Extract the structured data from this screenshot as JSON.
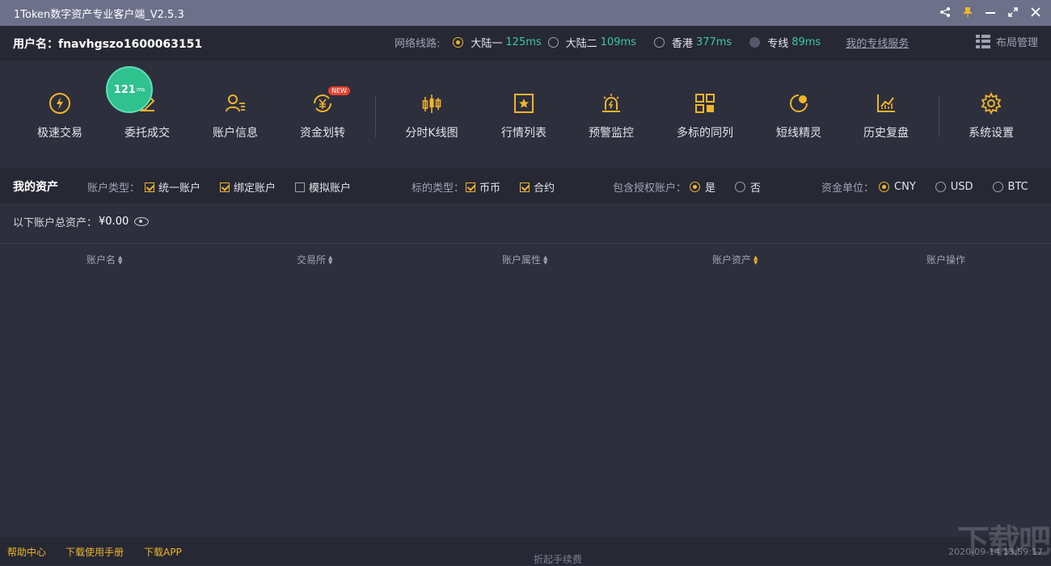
{
  "window": {
    "title": "1Token数字资产专业客户端_V2.5.3",
    "controls": [
      "share-icon",
      "pin-icon",
      "minimize-icon",
      "maximize-icon",
      "close-icon"
    ]
  },
  "user": {
    "label": "用户名：",
    "name": "fnavhgszo1600063151"
  },
  "network": {
    "label": "网络线路:",
    "options": [
      {
        "name": "大陆一",
        "ms": "125ms",
        "selected": true
      },
      {
        "name": "大陆二",
        "ms": "109ms",
        "selected": false
      },
      {
        "name": "香港",
        "ms": "377ms",
        "selected": false
      },
      {
        "name": "专线",
        "ms": "89ms",
        "selected": false
      }
    ],
    "service_link": "我的专线服务",
    "layout_label": "布局管理"
  },
  "ping": {
    "value": "121",
    "unit": "ms"
  },
  "toolbar": {
    "items": [
      {
        "label": "极速交易",
        "icon": "lightning-icon"
      },
      {
        "label": "委托成交",
        "icon": "edit-icon"
      },
      {
        "label": "账户信息",
        "icon": "user-info-icon"
      },
      {
        "label": "资金划转",
        "icon": "yuan-transfer-icon",
        "badge": "NEW"
      },
      {
        "label": "分时K线图",
        "icon": "candlestick-icon"
      },
      {
        "label": "行情列表",
        "icon": "star-list-icon"
      },
      {
        "label": "预警监控",
        "icon": "alarm-icon"
      },
      {
        "label": "多标的同列",
        "icon": "multi-grid-icon"
      },
      {
        "label": "短线精灵",
        "icon": "sprite-icon"
      },
      {
        "label": "历史复盘",
        "icon": "history-chart-icon"
      },
      {
        "label": "系统设置",
        "icon": "gear-icon"
      }
    ]
  },
  "assets": {
    "heading": "我的资产",
    "account_type_label": "账户类型：",
    "account_types": [
      {
        "label": "统一账户",
        "checked": true
      },
      {
        "label": "绑定账户",
        "checked": true
      },
      {
        "label": "模拟账户",
        "checked": false
      }
    ],
    "target_type_label": "标的类型：",
    "target_types": [
      {
        "label": "币币",
        "checked": true
      },
      {
        "label": "合约",
        "checked": true
      }
    ],
    "include_auth_label": "包含授权账户：",
    "include_auth": [
      {
        "label": "是",
        "selected": true
      },
      {
        "label": "否",
        "selected": false
      }
    ],
    "currency_label": "资金单位：",
    "currencies": [
      {
        "label": "CNY",
        "selected": true
      },
      {
        "label": "USD",
        "selected": false
      },
      {
        "label": "BTC",
        "selected": false
      }
    ],
    "total_label": "以下账户总资产：",
    "total_value": "¥0.00"
  },
  "table": {
    "columns": [
      "账户名",
      "交易所",
      "账户属性",
      "账户资产",
      "账户操作"
    ]
  },
  "footer": {
    "links": [
      "帮助中心",
      "下载使用手册",
      "下载APP"
    ],
    "collapse": "折起手续费",
    "time": "2020-09-14 13:59:17"
  },
  "colors": {
    "accent": "#f0b52b",
    "latency": "#3cc7a4",
    "titlebar": "#6c7089",
    "background": "#2d2f3d"
  }
}
